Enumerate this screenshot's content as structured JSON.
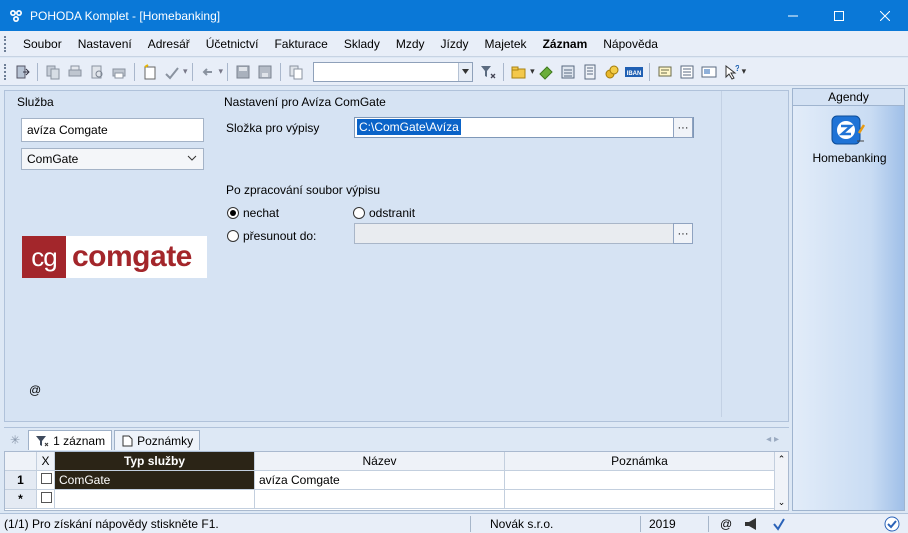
{
  "window": {
    "title": "POHODA Komplet - [Homebanking]"
  },
  "menu": [
    "Soubor",
    "Nastavení",
    "Adresář",
    "Účetnictví",
    "Fakturace",
    "Sklady",
    "Mzdy",
    "Jízdy",
    "Majetek",
    "Záznam",
    "Nápověda"
  ],
  "toolbar": {
    "combo_value": ""
  },
  "left": {
    "section_label": "Služba",
    "name_value": "avíza Comgate",
    "service_select": "ComGate",
    "logo_mark": "cg",
    "logo_word": "comgate",
    "at_symbol": "@"
  },
  "settings": {
    "section_label": "Nastavení pro Avíza ComGate",
    "folder_label": "Složka pro výpisy",
    "folder_value": "C:\\ComGate\\Avíza",
    "dots": "···",
    "after_label": "Po zpracování soubor výpisu",
    "opt_keep": "nechat",
    "opt_delete": "odstranit",
    "opt_move": "přesunout do:",
    "selected": "nechat"
  },
  "agendy": {
    "header": "Agendy",
    "item": "Homebanking"
  },
  "tabs": {
    "records": "1 záznam",
    "notes": "Poznámky"
  },
  "grid": {
    "headers": {
      "x": "X",
      "type": "Typ služby",
      "name": "Název",
      "note": "Poznámka"
    },
    "rows": [
      {
        "num": "1",
        "type": "ComGate",
        "name": "avíza Comgate",
        "note": ""
      }
    ],
    "new_row_marker": "*"
  },
  "status": {
    "help": "(1/1) Pro získání nápovědy stiskněte F1.",
    "company": "Novák s.r.o.",
    "year": "2019",
    "at": "@"
  },
  "colors": {
    "titlebar": "#0a78d7",
    "selection": "#0a63c8",
    "logo_red": "#a3262b",
    "current_row": "#2b2416"
  }
}
